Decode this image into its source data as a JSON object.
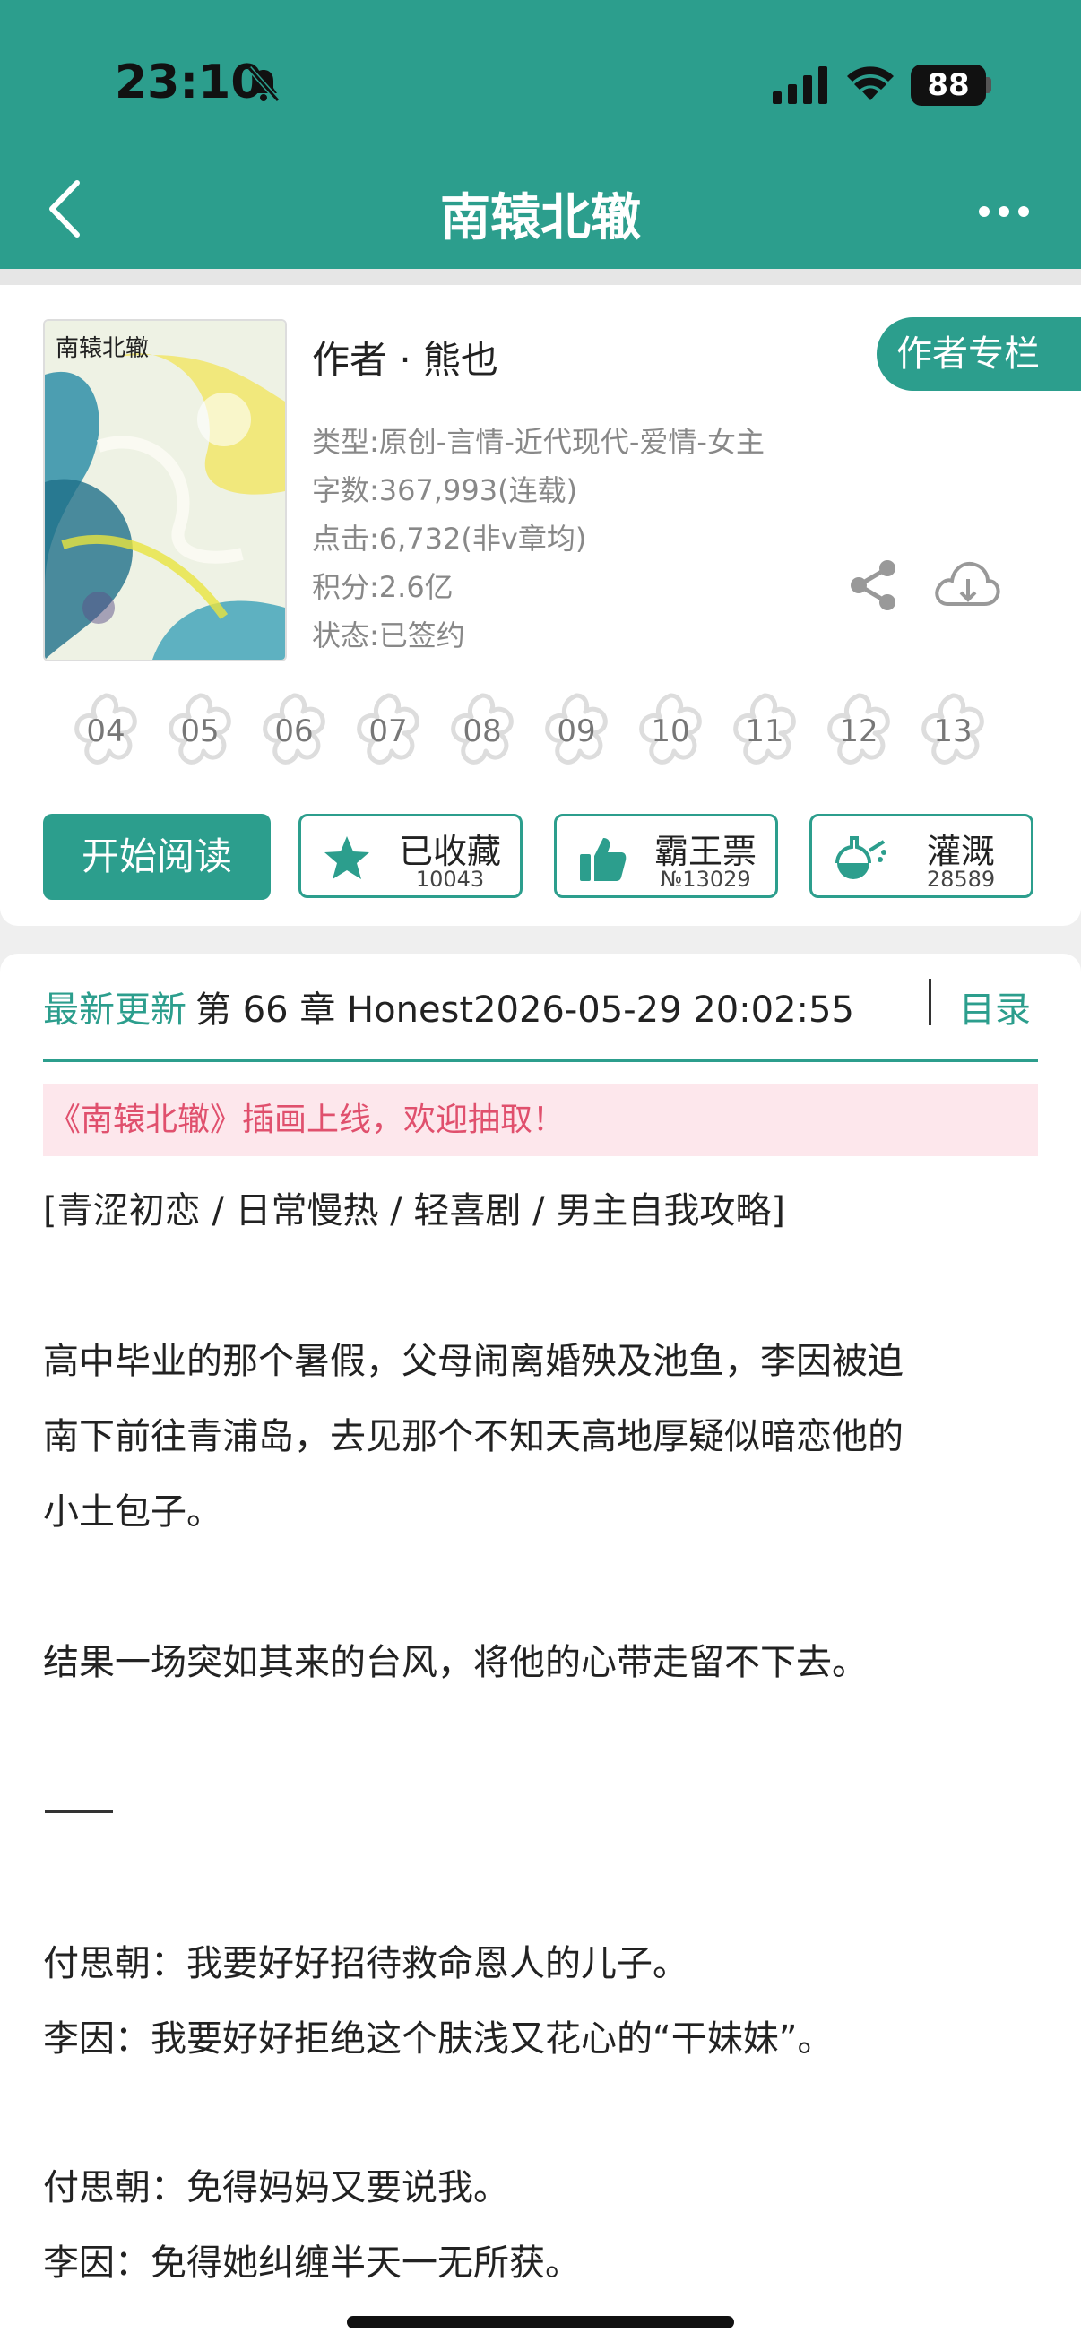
{
  "status_bar": {
    "time": "23:10",
    "battery": "88"
  },
  "header": {
    "title": "南辕北辙",
    "back_icon": "back-chevron-icon",
    "more_icon": "more-dots-icon",
    "bg_color": "#2c9e8d"
  },
  "book": {
    "cover_title": "南辕北辙",
    "author": "作者 · 熊也",
    "author_column_label": "作者专栏",
    "meta": [
      "类型:原创-言情-近代现代-爱情-女主",
      "字数:367,993(连载)",
      "点击:6,732(非v章均)",
      "积分:2.6亿",
      "状态:已签约"
    ]
  },
  "flowers": [
    "04",
    "05",
    "06",
    "07",
    "08",
    "09",
    "10",
    "11",
    "12",
    "13"
  ],
  "actions": {
    "read_label": "开始阅读",
    "collect": {
      "label": "已收藏",
      "count": "10043"
    },
    "vote": {
      "label": "霸王票",
      "count": "№13029"
    },
    "water": {
      "label": "灌溉",
      "count": "28589"
    }
  },
  "latest": {
    "label": "最新更新",
    "text": "第 66 章 Honest2026-05-29 20:02:55",
    "toc_label": "目录"
  },
  "notice": "《南辕北辙》插画上线，欢迎抽取！",
  "tags": "[青涩初恋 / 日常慢热 / 轻喜剧 / 男主自我攻略]",
  "intro": [
    "高中毕业的那个暑假，父母闹离婚殃及池鱼，李因被迫",
    "南下前往青浦岛，去见那个不知天高地厚疑似暗恋他的",
    "小土包子。",
    "结果一场突如其来的台风，将他的心带走留不下去。",
    "付思朝：我要好好招待救命恩人的儿子。",
    "李因：我要好好拒绝这个肤浅又花心的“干妹妹”。",
    "付思朝：免得妈妈又要说我。",
    "李因：免得她纠缠半天一无所获。"
  ]
}
